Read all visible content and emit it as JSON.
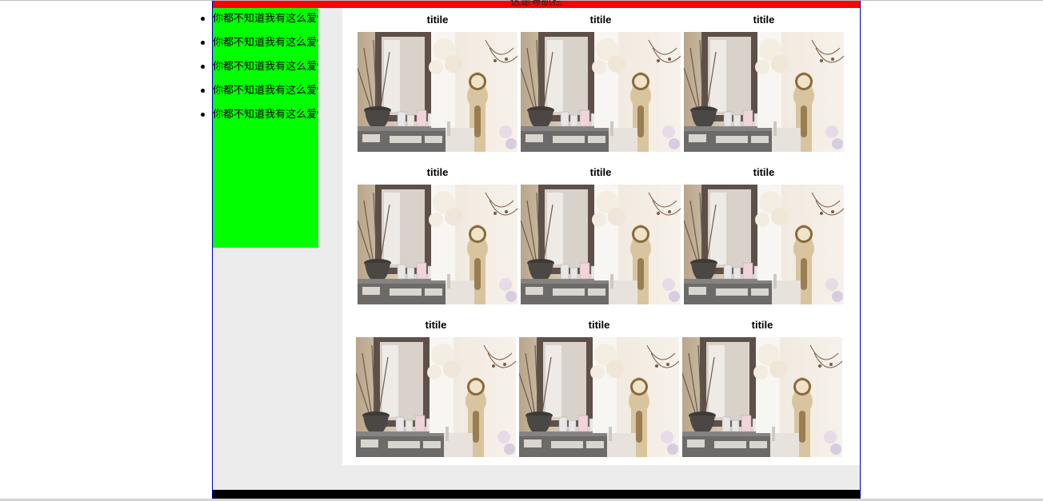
{
  "navbar": {
    "title": "这是导航栏"
  },
  "sidebar": {
    "items": [
      {
        "label": "你都不知道我有这么爱你"
      },
      {
        "label": "你都不知道我有这么爱你"
      },
      {
        "label": "你都不知道我有这么爱你"
      },
      {
        "label": "你都不知道我有这么爱你"
      },
      {
        "label": "你都不知道我有这么爱你"
      }
    ]
  },
  "gallery": {
    "cards": [
      {
        "title": "titile",
        "image": "room-interior-photo"
      },
      {
        "title": "titile",
        "image": "room-interior-photo"
      },
      {
        "title": "titile",
        "image": "room-interior-photo"
      },
      {
        "title": "titile",
        "image": "room-interior-photo"
      },
      {
        "title": "titile",
        "image": "room-interior-photo"
      },
      {
        "title": "titile",
        "image": "room-interior-photo"
      },
      {
        "title": "titile",
        "image": "room-interior-photo"
      },
      {
        "title": "titile",
        "image": "room-interior-photo"
      },
      {
        "title": "titile",
        "image": "room-interior-photo"
      }
    ]
  },
  "colors": {
    "navbar": "#ff0000",
    "sidebar": "#00ff00",
    "page_border": "#0000c8",
    "page_bg": "#ececec",
    "footer": "#000000"
  }
}
